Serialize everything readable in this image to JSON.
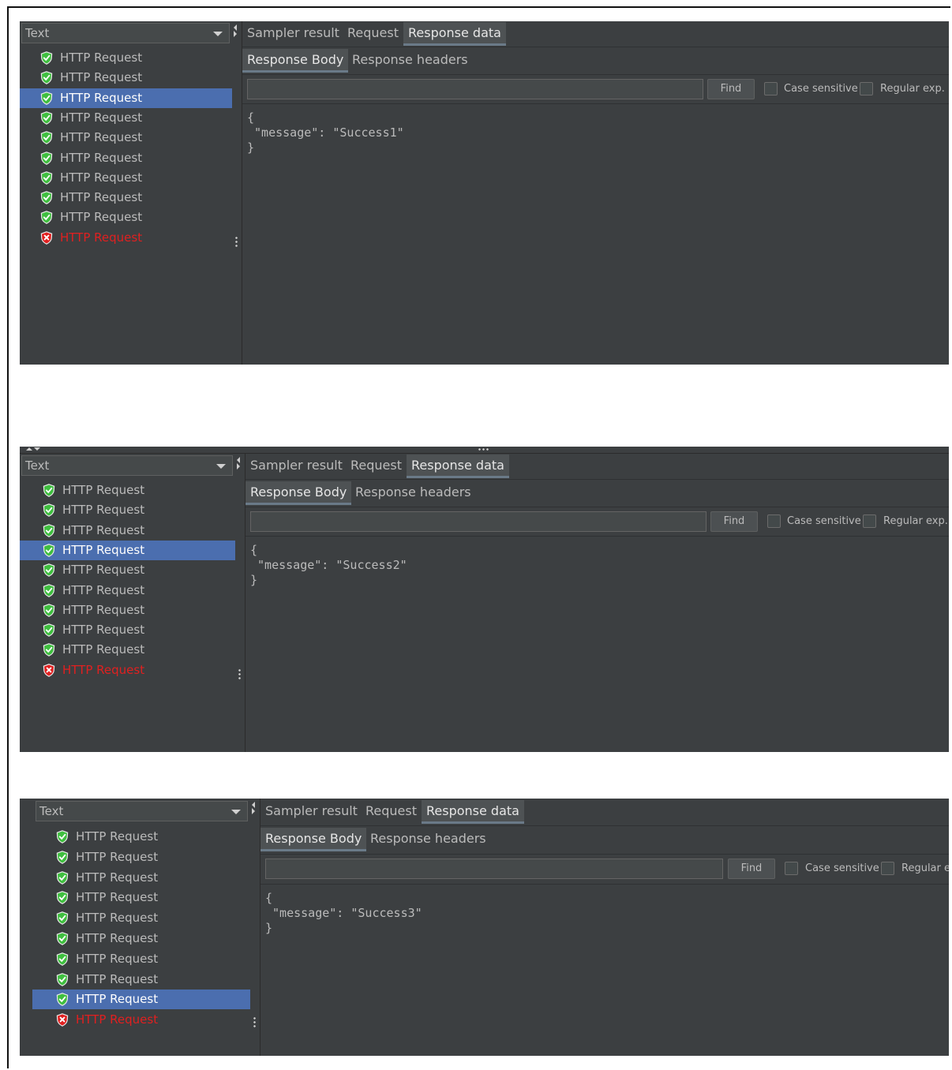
{
  "combo_value": "Text",
  "tabs": {
    "sampler_result": "Sampler result",
    "request": "Request",
    "response_data": "Response data"
  },
  "subtabs": {
    "response_body": "Response Body",
    "response_headers": "Response headers"
  },
  "find_label": "Find",
  "case_sensitive_label": "Case sensitive",
  "regular_exp_label": "Regular exp.",
  "regular_exp_label_cut": "Regular e",
  "tree_item_label": "HTTP Request",
  "panels": [
    {
      "selected_index": 2,
      "body": [
        "{",
        " \"message\": \"Success1\"",
        "}"
      ]
    },
    {
      "selected_index": 3,
      "body": [
        "{",
        " \"message\": \"Success2\"",
        "}"
      ]
    },
    {
      "selected_index": 8,
      "body": [
        "{",
        " \"message\": \"Success3\"",
        "}"
      ]
    }
  ],
  "colors": {
    "panel_bg": "#3c3f41",
    "selected_bg": "#4b6eaf",
    "error_text": "#e02020",
    "success_icon": "#3fbf3f",
    "error_icon": "#e02020"
  },
  "icons": {
    "success": "shield-check-icon",
    "error": "shield-x-icon"
  }
}
